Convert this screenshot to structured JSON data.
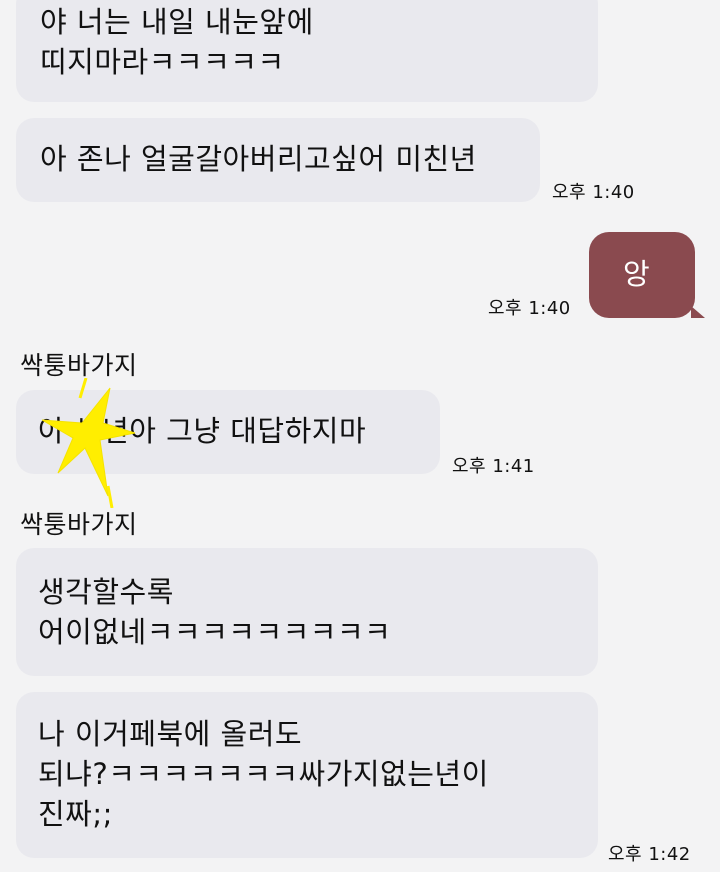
{
  "messages": [
    {
      "text": "야 너는 내일 내눈앞에\n띠지마라ㅋㅋㅋㅋㅋ"
    },
    {
      "text": "아 존나 얼굴갈아버리고싶어 미친년",
      "time": "오후 1:40"
    },
    {
      "text": "앙",
      "time": "오후 1:40"
    },
    {
      "sender": "싹퉁바가지",
      "text": "아 씹년아 그냥 대답하지마",
      "time": "오후 1:41"
    },
    {
      "sender": "싹퉁바가지",
      "text": "생각할수록\n어이없네ㅋㅋㅋㅋㅋㅋㅋㅋㅋ"
    },
    {
      "text": "나 이거페북에 올러도\n되냐?ㅋㅋㅋㅋㅋㅋㅋ싸가지없는년이\n진짜;;",
      "time": "오후 1:42"
    }
  ],
  "colors": {
    "background": "#f3f3f4",
    "received_bubble": "#e9e9ee",
    "sent_bubble": "#8a4a4f",
    "sticker": "#ffee00"
  },
  "icons": [
    "sparkle-sticker"
  ]
}
